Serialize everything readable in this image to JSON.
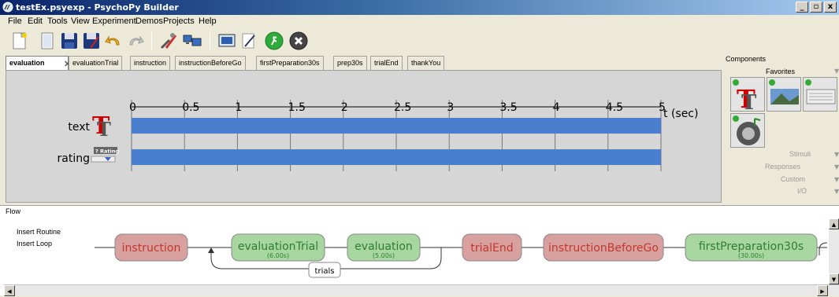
{
  "window": {
    "title": "testEx.psyexp - PsychoPy Builder",
    "controls": [
      "_",
      "̅",
      "x"
    ]
  },
  "menu": [
    "File",
    "Edit",
    "Tools",
    "View",
    "Experiment",
    "Demos",
    "Projects",
    "Help"
  ],
  "toolbar_icons": [
    "new-file-icon",
    "open-file-icon",
    "save-icon",
    "save-as-icon",
    "undo-icon",
    "redo-icon",
    "preferences-icon",
    "monitor-center-icon",
    "experiment-settings-icon",
    "compile-script-icon",
    "run-icon",
    "stop-icon"
  ],
  "routine_tabs": [
    "evaluation",
    "evaluationTrial",
    "instruction",
    "instructionBeforeGo",
    "firstPreparation30s",
    "prep30s",
    "trialEnd",
    "thankYou"
  ],
  "active_tab": "evaluation",
  "timeline": {
    "ticks": [
      "0",
      "0.5",
      "1",
      "1.5",
      "2",
      "2.5",
      "3",
      "3.5",
      "4",
      "4.5",
      "5"
    ],
    "unit_label": "t (sec)",
    "components": [
      {
        "name": "text",
        "icon": "text-component-icon",
        "start": 0,
        "stop": 5,
        "color": "#4a7fd0"
      },
      {
        "name": "rating",
        "icon": "rating-component-icon",
        "icon_label": "? Rating",
        "start": 0,
        "stop": 5,
        "color": "#4a7fd0"
      }
    ]
  },
  "components_panel": {
    "title": "Components",
    "favorites_label": "Favorites",
    "favorites": [
      "text-component-icon",
      "image-component-icon",
      "keyboard-component-icon",
      "sound-component-icon"
    ],
    "categories": [
      "Stimuli",
      "Responses",
      "Custom",
      "I/O"
    ]
  },
  "flow": {
    "title": "Flow",
    "insert_routine": "Insert Routine",
    "insert_loop": "Insert Loop",
    "routines": [
      {
        "name": "instruction",
        "duration": "",
        "type": "nonslip",
        "color": "#d9a0a0",
        "text_color": "#c0392b"
      },
      {
        "name": "evaluationTrial",
        "duration": "(6.00s)",
        "type": "timed",
        "color": "#a8d6a0",
        "text_color": "#2e7d32"
      },
      {
        "name": "evaluation",
        "duration": "(5.00s)",
        "type": "timed",
        "color": "#a8d6a0",
        "text_color": "#2e7d32"
      },
      {
        "name": "trialEnd",
        "duration": "",
        "type": "nonslip",
        "color": "#d9a0a0",
        "text_color": "#c0392b"
      },
      {
        "name": "instructionBeforeGo",
        "duration": "",
        "type": "nonslip",
        "color": "#d9a0a0",
        "text_color": "#c0392b"
      },
      {
        "name": "firstPreparation30s",
        "duration": "(30.00s)",
        "type": "timed",
        "color": "#a8d6a0",
        "text_color": "#2e7d32"
      }
    ],
    "loop": {
      "name": "trials"
    }
  }
}
